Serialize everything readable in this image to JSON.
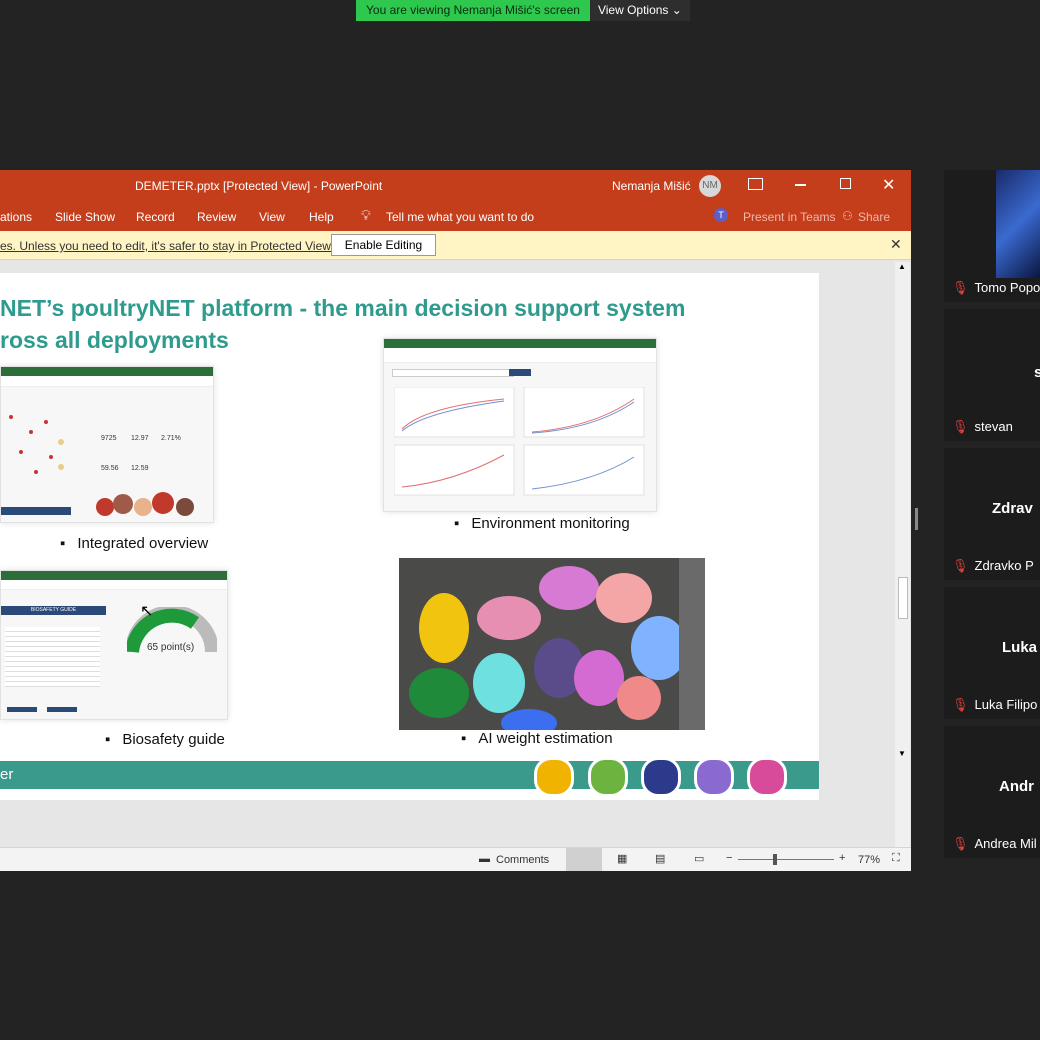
{
  "banner": {
    "viewing": "You are viewing Nemanja Mišić's screen",
    "view_options": "View Options ⌄"
  },
  "window": {
    "title": "DEMETER.pptx [Protected View]  -  PowerPoint",
    "user": "Nemanja Mišić",
    "initials": "NM"
  },
  "ribbon": {
    "tabs": [
      "ations",
      "Slide Show",
      "Record",
      "Review",
      "View",
      "Help"
    ],
    "tell_me": "Tell me what you want to do",
    "present_teams": "Present in Teams",
    "share": "Share"
  },
  "protected": {
    "message": "es. Unless you need to edit, it's safer to stay in Protected View.",
    "enable": "Enable Editing"
  },
  "slide": {
    "title_line1": "NET’s poultryNET platform - the main decision support system",
    "title_line2": "ross all deployments",
    "bullets": [
      "Integrated overview",
      "Environment monitoring",
      "Biosafety guide",
      "AI weight estimation"
    ],
    "gauge_label": "65 point(s)",
    "footer_text": "er",
    "biosafety_title": "BIOSAFETY GUIDE",
    "mini_stats": [
      "9725",
      "12.97",
      "2.71%",
      "59.56",
      "12.59"
    ]
  },
  "status": {
    "comments": "Comments",
    "zoom": "77%"
  },
  "participants": [
    {
      "name": "Tomo Popo"
    },
    {
      "name": "stevan",
      "big": "s"
    },
    {
      "name": "Zdravko P",
      "big": "Zdrav"
    },
    {
      "name": "Luka Filipo",
      "big": "Luka"
    },
    {
      "name": "Andrea Mil",
      "big": "Andr"
    }
  ],
  "colors": {
    "ppt_red": "#c43e1c",
    "teal": "#3a9a8c",
    "title_teal": "#2f9a8e",
    "green": "#2dc84d"
  }
}
